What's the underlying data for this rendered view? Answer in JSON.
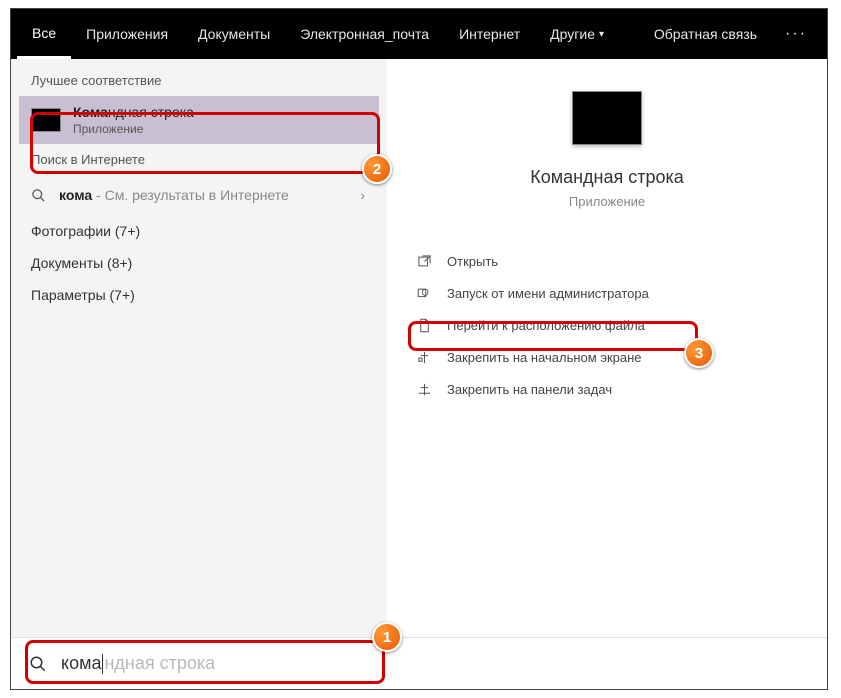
{
  "tabs": {
    "all": "Все",
    "apps": "Приложения",
    "docs": "Документы",
    "email": "Электронная_почта",
    "web": "Интернет",
    "other": "Другие"
  },
  "feedback": "Обратная связь",
  "left": {
    "best_match_label": "Лучшее соответствие",
    "best_match": {
      "prefix": "Кома",
      "suffix": "ндная строка",
      "subtitle": "Приложение"
    },
    "web_label": "Поиск в Интернете",
    "web_query": "кома",
    "web_hint": " - См. результаты в Интернете",
    "cats": {
      "photos": "Фотографии (7+)",
      "documents": "Документы (8+)",
      "settings": "Параметры (7+)"
    }
  },
  "right": {
    "title": "Командная строка",
    "subtitle": "Приложение",
    "actions": {
      "open": "Открыть",
      "admin": "Запуск от имени администратора",
      "location": "Перейти к расположению файла",
      "pin_start": "Закрепить на начальном экране",
      "pin_taskbar": "Закрепить на панели задач"
    }
  },
  "search": {
    "typed": "кома",
    "ghost": "ндная строка"
  },
  "badges": {
    "b1": "1",
    "b2": "2",
    "b3": "3"
  }
}
